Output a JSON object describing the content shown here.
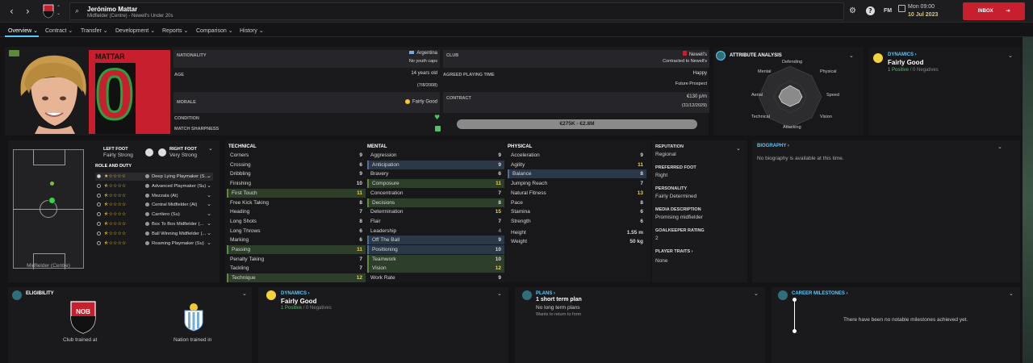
{
  "topbar": {
    "player_name": "Jerónimo Mattar",
    "player_subtitle": "Midfielder (Centre) - Newell's Under 20s",
    "club_crest_label": "NOB",
    "date_day": "Mon 09:00",
    "date": "10 Jul 2023",
    "inbox_label": "INBOX",
    "fm_label": "FM"
  },
  "tabs": [
    {
      "label": "Overview"
    },
    {
      "label": "Contract"
    },
    {
      "label": "Transfer"
    },
    {
      "label": "Development"
    },
    {
      "label": "Reports"
    },
    {
      "label": "Comparison"
    },
    {
      "label": "History"
    }
  ],
  "profile": {
    "name_banner": "MATTAR",
    "shirt_number": "0",
    "nationality_label": "NATIONALITY",
    "nationality": "Argentina",
    "youth_caps": "No youth caps",
    "age_label": "AGE",
    "age": "14 years old",
    "dob": "(7/8/2008)",
    "morale_label": "MORALE",
    "morale": "Fairly Good",
    "condition_label": "CONDITION",
    "sharpness_label": "MATCH SHARPNESS",
    "club_label": "CLUB",
    "club": "Newell's",
    "club_contract": "Contracted to Newell's",
    "agreed_label": "AGREED PLAYING TIME",
    "agreed_value": "Happy",
    "agreed_sub": "Future Prospect",
    "contract_label": "CONTRACT",
    "wage": "€130 p/m",
    "contract_end": "(31/12/2029)",
    "value_range": "€275K - €2.8M"
  },
  "attribute_analysis": {
    "title": "ATTRIBUTE ANALYSIS",
    "labels": [
      "Defending",
      "Physical",
      "Speed",
      "Vision",
      "Attacking",
      "Technical",
      "Aerial",
      "Mental"
    ]
  },
  "dynamics_top": {
    "title": "DYNAMICS",
    "value": "Fairly Good",
    "positive": "1 Positive",
    "negative": "0 Negatives"
  },
  "position": {
    "left_foot_label": "LEFT FOOT",
    "left_foot": "Fairly Strong",
    "right_foot_label": "RIGHT FOOT",
    "right_foot": "Very Strong",
    "role_duty_label": "ROLE AND DUTY",
    "pitch_caption": "Midfielder (Centre)",
    "roles": [
      {
        "name": "Deep Lying Playmaker (S...",
        "stars": 1
      },
      {
        "name": "Advanced Playmaker (Su)",
        "stars": 0.5
      },
      {
        "name": "Mezzala (At)",
        "stars": 0.5
      },
      {
        "name": "Central Midfielder (At)",
        "stars": 0.5
      },
      {
        "name": "Carrilero (Su)",
        "stars": 0.5
      },
      {
        "name": "Box To Box Midfielder (...",
        "stars": 0.5
      },
      {
        "name": "Ball Winning Midfielder (...",
        "stars": 0.5
      },
      {
        "name": "Roaming Playmaker (Su)",
        "stars": 0.5
      }
    ]
  },
  "technical": {
    "title": "TECHNICAL",
    "rows": [
      {
        "name": "Corners",
        "value": "9",
        "hl": ""
      },
      {
        "name": "Crossing",
        "value": "6",
        "hl": ""
      },
      {
        "name": "Dribbling",
        "value": "9",
        "hl": ""
      },
      {
        "name": "Finishing",
        "value": "10",
        "hl": ""
      },
      {
        "name": "First Touch",
        "value": "11",
        "hl": "green"
      },
      {
        "name": "Free Kick Taking",
        "value": "8",
        "hl": ""
      },
      {
        "name": "Heading",
        "value": "7",
        "hl": ""
      },
      {
        "name": "Long Shots",
        "value": "8",
        "hl": ""
      },
      {
        "name": "Long Throws",
        "value": "6",
        "hl": ""
      },
      {
        "name": "Marking",
        "value": "6",
        "hl": ""
      },
      {
        "name": "Passing",
        "value": "11",
        "hl": "green"
      },
      {
        "name": "Penalty Taking",
        "value": "7",
        "hl": ""
      },
      {
        "name": "Tackling",
        "value": "7",
        "hl": ""
      },
      {
        "name": "Technique",
        "value": "12",
        "hl": "green"
      }
    ]
  },
  "mental": {
    "title": "MENTAL",
    "rows": [
      {
        "name": "Aggression",
        "value": "9",
        "hl": ""
      },
      {
        "name": "Anticipation",
        "value": "9",
        "hl": "blue"
      },
      {
        "name": "Bravery",
        "value": "6",
        "hl": ""
      },
      {
        "name": "Composure",
        "value": "11",
        "hl": "green"
      },
      {
        "name": "Concentration",
        "value": "7",
        "hl": ""
      },
      {
        "name": "Decisions",
        "value": "8",
        "hl": "green"
      },
      {
        "name": "Determination",
        "value": "15",
        "hl": ""
      },
      {
        "name": "Flair",
        "value": "7",
        "hl": ""
      },
      {
        "name": "Leadership",
        "value": "4",
        "hl": ""
      },
      {
        "name": "Off The Ball",
        "value": "9",
        "hl": "blue"
      },
      {
        "name": "Positioning",
        "value": "10",
        "hl": "blue"
      },
      {
        "name": "Teamwork",
        "value": "10",
        "hl": "green"
      },
      {
        "name": "Vision",
        "value": "12",
        "hl": "green"
      },
      {
        "name": "Work Rate",
        "value": "9",
        "hl": ""
      }
    ]
  },
  "physical": {
    "title": "PHYSICAL",
    "rows": [
      {
        "name": "Acceleration",
        "value": "9",
        "hl": ""
      },
      {
        "name": "Agility",
        "value": "11",
        "hl": ""
      },
      {
        "name": "Balance",
        "value": "8",
        "hl": "blue"
      },
      {
        "name": "Jumping Reach",
        "value": "7",
        "hl": ""
      },
      {
        "name": "Natural Fitness",
        "value": "13",
        "hl": ""
      },
      {
        "name": "Pace",
        "value": "8",
        "hl": ""
      },
      {
        "name": "Stamina",
        "value": "6",
        "hl": ""
      },
      {
        "name": "Strength",
        "value": "6",
        "hl": ""
      }
    ],
    "height_label": "Height",
    "height": "1.55 m",
    "weight_label": "Weight",
    "weight": "50 kg"
  },
  "info": {
    "reputation_label": "REPUTATION",
    "reputation": "Regional",
    "pref_foot_label": "PREFERRED FOOT",
    "pref_foot": "Right",
    "personality_label": "PERSONALITY",
    "personality": "Fairly Determined",
    "media_label": "MEDIA DESCRIPTION",
    "media": "Promising midfielder",
    "gk_label": "GOALKEEPER RATING",
    "gk": "2",
    "traits_label": "PLAYER TRAITS",
    "traits": "None"
  },
  "biography": {
    "title": "BIOGRAPHY",
    "text": "No biography is available at this time."
  },
  "eligibility": {
    "title": "ELIGIBILITY",
    "club_trained": "Club trained at",
    "nation_trained": "Nation trained in",
    "crest_text": "NOB"
  },
  "dynamics_bottom": {
    "title": "DYNAMICS",
    "value": "Fairly Good",
    "positive": "1 Positive",
    "negative": "0 Negatives"
  },
  "plans": {
    "title": "PLANS",
    "short_term": "1 short term plan",
    "long_term": "No long term plans",
    "sub": "Wants to return to form"
  },
  "milestones": {
    "title": "CAREER MILESTONES",
    "text": "There have been no notable milestones achieved yet."
  },
  "colors": {
    "accent": "#5ac8fa",
    "club_red": "#c71f2d",
    "highlight_yellow": "#f3d33a",
    "positive_green": "#4fc36a"
  }
}
